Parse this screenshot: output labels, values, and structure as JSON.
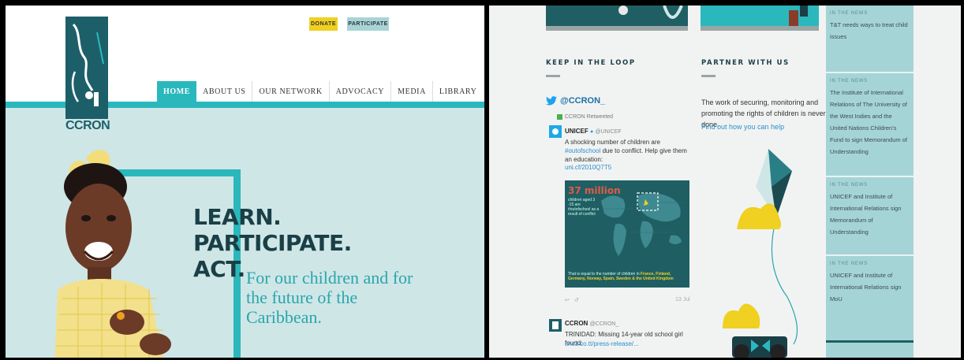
{
  "left": {
    "top_buttons": {
      "donate": "DONATE",
      "participate": "PARTICIPATE"
    },
    "logo_text": "CCRON",
    "nav": [
      "HOME",
      "ABOUT US",
      "OUR NETWORK",
      "ADVOCACY",
      "MEDIA",
      "LIBRARY"
    ],
    "headline": [
      "LEARN.",
      "PARTICIPATE.",
      "ACT."
    ],
    "tagline": "For our children and for the future of the Caribbean."
  },
  "right": {
    "keep_in_loop": {
      "title": "KEEP IN THE LOOP",
      "twitter_handle": "@CCRON_",
      "retweeted": "CCRON Retweeted",
      "tweet1": {
        "name": "UNICEF",
        "handle": "@UNICEF",
        "text_before": "A shocking number of children are ",
        "hashtag": "#outofschool",
        "text_after": " due to conflict. Help give them an education:",
        "link": "uni.cf/2010Q7T5"
      },
      "image": {
        "big": "37 million",
        "small": "children aged 3 -15 are #outofschool as a result of conflict",
        "bottom_before": "That is equal to the number of children in ",
        "bottom_highlight": "France, Finland, Germany, Norway, Spain, Sweden & the United Kingdom"
      },
      "tweet1_date": "13 Jul",
      "tweet2": {
        "name": "CCRON",
        "handle": "@CCRON_",
        "text": "TRINIDAD: Missing 14-year old school girl found:",
        "link": "cnc3.co.tt/press-release/..."
      }
    },
    "partner": {
      "title": "PARTNER WITH US",
      "text": "The work of securing, monitoring and promoting the rights of children is never done.",
      "link": "Find out how you can help"
    },
    "news": [
      {
        "tag": "IN THE NEWS",
        "text": "T&T needs ways to treat child issues"
      },
      {
        "tag": "IN THE NEWS",
        "text": "The Institute of International Relations of The University of the West Indies and the United Nations Children's Fund to sign Memorandum of Understanding"
      },
      {
        "tag": "IN THE NEWS",
        "text": "UNICEF and Institute of International Relations sign Memorandum of Understanding"
      },
      {
        "tag": "IN THE NEWS",
        "text": "UNICEF and Institute of International Relations sign MoU"
      }
    ]
  },
  "colors": {
    "teal": "#2ab8bd",
    "dark_teal": "#1d5f69",
    "pale_teal": "#cfe6e7",
    "yellow": "#f0d020",
    "news_bg": "#a5d4d7"
  },
  "icons": [
    "twitter-bird-icon",
    "retweet-icon",
    "verified-icon"
  ]
}
